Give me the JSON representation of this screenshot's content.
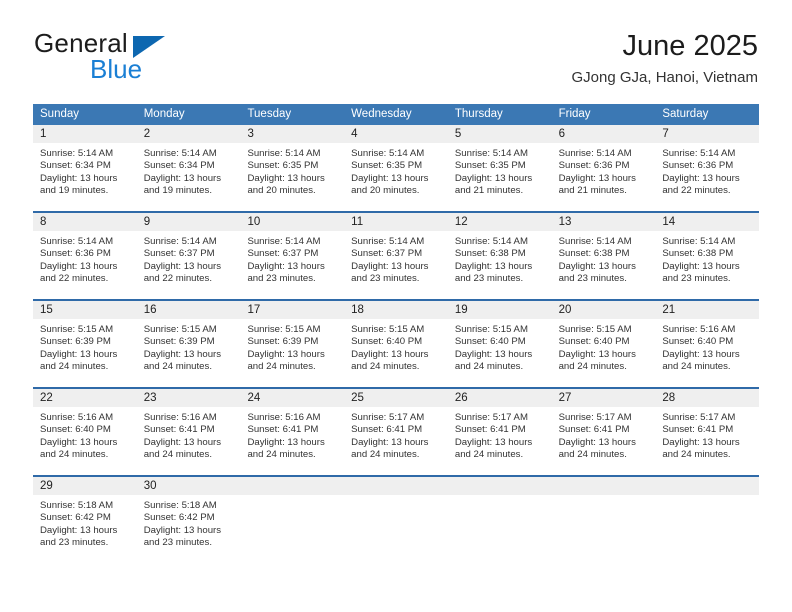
{
  "brand": {
    "word_one": "General",
    "word_two": "Blue",
    "logo_icon": "triangle-logo-icon"
  },
  "header": {
    "title": "June 2025",
    "location": "GJong GJa, Hanoi, Vietnam"
  },
  "colors": {
    "header_blue": "#3b78b4",
    "row_divider_blue": "#2f6aa8",
    "day_number_bg": "#efefef",
    "brand_blue": "#1a7fd4",
    "logo_blue": "#0d67b0"
  },
  "calendar": {
    "day_headers": [
      "Sunday",
      "Monday",
      "Tuesday",
      "Wednesday",
      "Thursday",
      "Friday",
      "Saturday"
    ],
    "weeks": [
      [
        {
          "day": "1",
          "sunrise": "Sunrise: 5:14 AM",
          "sunset": "Sunset: 6:34 PM",
          "daylight1": "Daylight: 13 hours",
          "daylight2": "and 19 minutes."
        },
        {
          "day": "2",
          "sunrise": "Sunrise: 5:14 AM",
          "sunset": "Sunset: 6:34 PM",
          "daylight1": "Daylight: 13 hours",
          "daylight2": "and 19 minutes."
        },
        {
          "day": "3",
          "sunrise": "Sunrise: 5:14 AM",
          "sunset": "Sunset: 6:35 PM",
          "daylight1": "Daylight: 13 hours",
          "daylight2": "and 20 minutes."
        },
        {
          "day": "4",
          "sunrise": "Sunrise: 5:14 AM",
          "sunset": "Sunset: 6:35 PM",
          "daylight1": "Daylight: 13 hours",
          "daylight2": "and 20 minutes."
        },
        {
          "day": "5",
          "sunrise": "Sunrise: 5:14 AM",
          "sunset": "Sunset: 6:35 PM",
          "daylight1": "Daylight: 13 hours",
          "daylight2": "and 21 minutes."
        },
        {
          "day": "6",
          "sunrise": "Sunrise: 5:14 AM",
          "sunset": "Sunset: 6:36 PM",
          "daylight1": "Daylight: 13 hours",
          "daylight2": "and 21 minutes."
        },
        {
          "day": "7",
          "sunrise": "Sunrise: 5:14 AM",
          "sunset": "Sunset: 6:36 PM",
          "daylight1": "Daylight: 13 hours",
          "daylight2": "and 22 minutes."
        }
      ],
      [
        {
          "day": "8",
          "sunrise": "Sunrise: 5:14 AM",
          "sunset": "Sunset: 6:36 PM",
          "daylight1": "Daylight: 13 hours",
          "daylight2": "and 22 minutes."
        },
        {
          "day": "9",
          "sunrise": "Sunrise: 5:14 AM",
          "sunset": "Sunset: 6:37 PM",
          "daylight1": "Daylight: 13 hours",
          "daylight2": "and 22 minutes."
        },
        {
          "day": "10",
          "sunrise": "Sunrise: 5:14 AM",
          "sunset": "Sunset: 6:37 PM",
          "daylight1": "Daylight: 13 hours",
          "daylight2": "and 23 minutes."
        },
        {
          "day": "11",
          "sunrise": "Sunrise: 5:14 AM",
          "sunset": "Sunset: 6:37 PM",
          "daylight1": "Daylight: 13 hours",
          "daylight2": "and 23 minutes."
        },
        {
          "day": "12",
          "sunrise": "Sunrise: 5:14 AM",
          "sunset": "Sunset: 6:38 PM",
          "daylight1": "Daylight: 13 hours",
          "daylight2": "and 23 minutes."
        },
        {
          "day": "13",
          "sunrise": "Sunrise: 5:14 AM",
          "sunset": "Sunset: 6:38 PM",
          "daylight1": "Daylight: 13 hours",
          "daylight2": "and 23 minutes."
        },
        {
          "day": "14",
          "sunrise": "Sunrise: 5:14 AM",
          "sunset": "Sunset: 6:38 PM",
          "daylight1": "Daylight: 13 hours",
          "daylight2": "and 23 minutes."
        }
      ],
      [
        {
          "day": "15",
          "sunrise": "Sunrise: 5:15 AM",
          "sunset": "Sunset: 6:39 PM",
          "daylight1": "Daylight: 13 hours",
          "daylight2": "and 24 minutes."
        },
        {
          "day": "16",
          "sunrise": "Sunrise: 5:15 AM",
          "sunset": "Sunset: 6:39 PM",
          "daylight1": "Daylight: 13 hours",
          "daylight2": "and 24 minutes."
        },
        {
          "day": "17",
          "sunrise": "Sunrise: 5:15 AM",
          "sunset": "Sunset: 6:39 PM",
          "daylight1": "Daylight: 13 hours",
          "daylight2": "and 24 minutes."
        },
        {
          "day": "18",
          "sunrise": "Sunrise: 5:15 AM",
          "sunset": "Sunset: 6:40 PM",
          "daylight1": "Daylight: 13 hours",
          "daylight2": "and 24 minutes."
        },
        {
          "day": "19",
          "sunrise": "Sunrise: 5:15 AM",
          "sunset": "Sunset: 6:40 PM",
          "daylight1": "Daylight: 13 hours",
          "daylight2": "and 24 minutes."
        },
        {
          "day": "20",
          "sunrise": "Sunrise: 5:15 AM",
          "sunset": "Sunset: 6:40 PM",
          "daylight1": "Daylight: 13 hours",
          "daylight2": "and 24 minutes."
        },
        {
          "day": "21",
          "sunrise": "Sunrise: 5:16 AM",
          "sunset": "Sunset: 6:40 PM",
          "daylight1": "Daylight: 13 hours",
          "daylight2": "and 24 minutes."
        }
      ],
      [
        {
          "day": "22",
          "sunrise": "Sunrise: 5:16 AM",
          "sunset": "Sunset: 6:40 PM",
          "daylight1": "Daylight: 13 hours",
          "daylight2": "and 24 minutes."
        },
        {
          "day": "23",
          "sunrise": "Sunrise: 5:16 AM",
          "sunset": "Sunset: 6:41 PM",
          "daylight1": "Daylight: 13 hours",
          "daylight2": "and 24 minutes."
        },
        {
          "day": "24",
          "sunrise": "Sunrise: 5:16 AM",
          "sunset": "Sunset: 6:41 PM",
          "daylight1": "Daylight: 13 hours",
          "daylight2": "and 24 minutes."
        },
        {
          "day": "25",
          "sunrise": "Sunrise: 5:17 AM",
          "sunset": "Sunset: 6:41 PM",
          "daylight1": "Daylight: 13 hours",
          "daylight2": "and 24 minutes."
        },
        {
          "day": "26",
          "sunrise": "Sunrise: 5:17 AM",
          "sunset": "Sunset: 6:41 PM",
          "daylight1": "Daylight: 13 hours",
          "daylight2": "and 24 minutes."
        },
        {
          "day": "27",
          "sunrise": "Sunrise: 5:17 AM",
          "sunset": "Sunset: 6:41 PM",
          "daylight1": "Daylight: 13 hours",
          "daylight2": "and 24 minutes."
        },
        {
          "day": "28",
          "sunrise": "Sunrise: 5:17 AM",
          "sunset": "Sunset: 6:41 PM",
          "daylight1": "Daylight: 13 hours",
          "daylight2": "and 24 minutes."
        }
      ],
      [
        {
          "day": "29",
          "sunrise": "Sunrise: 5:18 AM",
          "sunset": "Sunset: 6:42 PM",
          "daylight1": "Daylight: 13 hours",
          "daylight2": "and 23 minutes."
        },
        {
          "day": "30",
          "sunrise": "Sunrise: 5:18 AM",
          "sunset": "Sunset: 6:42 PM",
          "daylight1": "Daylight: 13 hours",
          "daylight2": "and 23 minutes."
        },
        {
          "day": "",
          "sunrise": "",
          "sunset": "",
          "daylight1": "",
          "daylight2": ""
        },
        {
          "day": "",
          "sunrise": "",
          "sunset": "",
          "daylight1": "",
          "daylight2": ""
        },
        {
          "day": "",
          "sunrise": "",
          "sunset": "",
          "daylight1": "",
          "daylight2": ""
        },
        {
          "day": "",
          "sunrise": "",
          "sunset": "",
          "daylight1": "",
          "daylight2": ""
        },
        {
          "day": "",
          "sunrise": "",
          "sunset": "",
          "daylight1": "",
          "daylight2": ""
        }
      ]
    ]
  }
}
